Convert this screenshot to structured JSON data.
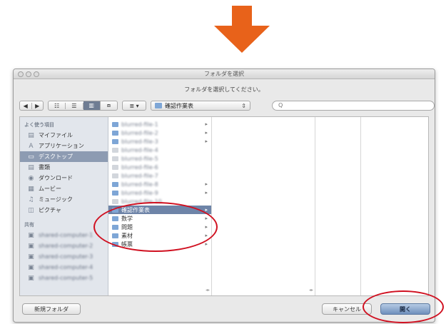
{
  "colors": {
    "arrow": "#e8621a",
    "highlight_ring": "#d01020",
    "selection": "#6e84a8"
  },
  "window": {
    "title": "フォルダを選択",
    "prompt": "フォルダを選択してください。"
  },
  "toolbar": {
    "back_forward": [
      "◀",
      "▶"
    ],
    "view_modes": [
      "☷",
      "☰",
      "▥",
      "⧈"
    ],
    "arrange": "≣ ▾",
    "location_label": "確認作業表",
    "location_arrows": "⇕",
    "search_placeholder": "Q"
  },
  "sidebar": {
    "favorites_header": "よく使う項目",
    "items": [
      {
        "icon": "document-icon",
        "glyph": "▤",
        "label": "マイファイル"
      },
      {
        "icon": "applications-icon",
        "glyph": "A",
        "label": "アプリケーション"
      },
      {
        "icon": "desktop-icon",
        "glyph": "▭",
        "label": "デスクトップ",
        "selected": true
      },
      {
        "icon": "documents-icon",
        "glyph": "▤",
        "label": "書類"
      },
      {
        "icon": "download-icon",
        "glyph": "◉",
        "label": "ダウンロード"
      },
      {
        "icon": "movies-icon",
        "glyph": "▦",
        "label": "ムービー"
      },
      {
        "icon": "music-icon",
        "glyph": "♫",
        "label": "ミュージック"
      },
      {
        "icon": "pictures-icon",
        "glyph": "◫",
        "label": "ピクチャ"
      }
    ],
    "shared_header": "共有",
    "shared_items": [
      "shared-computer-1",
      "shared-computer-2",
      "shared-computer-3",
      "shared-computer-4",
      "shared-computer-5"
    ]
  },
  "column1": {
    "items": [
      {
        "label": "blurred-file-1",
        "folder": true,
        "blur": true
      },
      {
        "label": "blurred-file-2",
        "folder": true,
        "blur": true
      },
      {
        "label": "blurred-file-3",
        "folder": true,
        "blur": true
      },
      {
        "label": "blurred-file-4",
        "folder": false,
        "blur": true
      },
      {
        "label": "blurred-file-5",
        "folder": false,
        "blur": true
      },
      {
        "label": "blurred-file-6",
        "folder": false,
        "blur": true
      },
      {
        "label": "blurred-file-7",
        "folder": false,
        "blur": true
      },
      {
        "label": "blurred-file-8",
        "folder": true,
        "blur": true
      },
      {
        "label": "blurred-file-9",
        "folder": true,
        "blur": true
      },
      {
        "label": "blurred-file-10",
        "folder": false,
        "blur": true
      },
      {
        "label": "確認作業表",
        "folder": true,
        "selected": true
      },
      {
        "label": "数学",
        "folder": true
      },
      {
        "label": "問題",
        "folder": true
      },
      {
        "label": "素材",
        "folder": true
      },
      {
        "label": "帳票",
        "folder": true
      }
    ]
  },
  "bottom": {
    "new_folder": "新規フォルダ",
    "cancel": "キャンセル",
    "open": "開く"
  }
}
